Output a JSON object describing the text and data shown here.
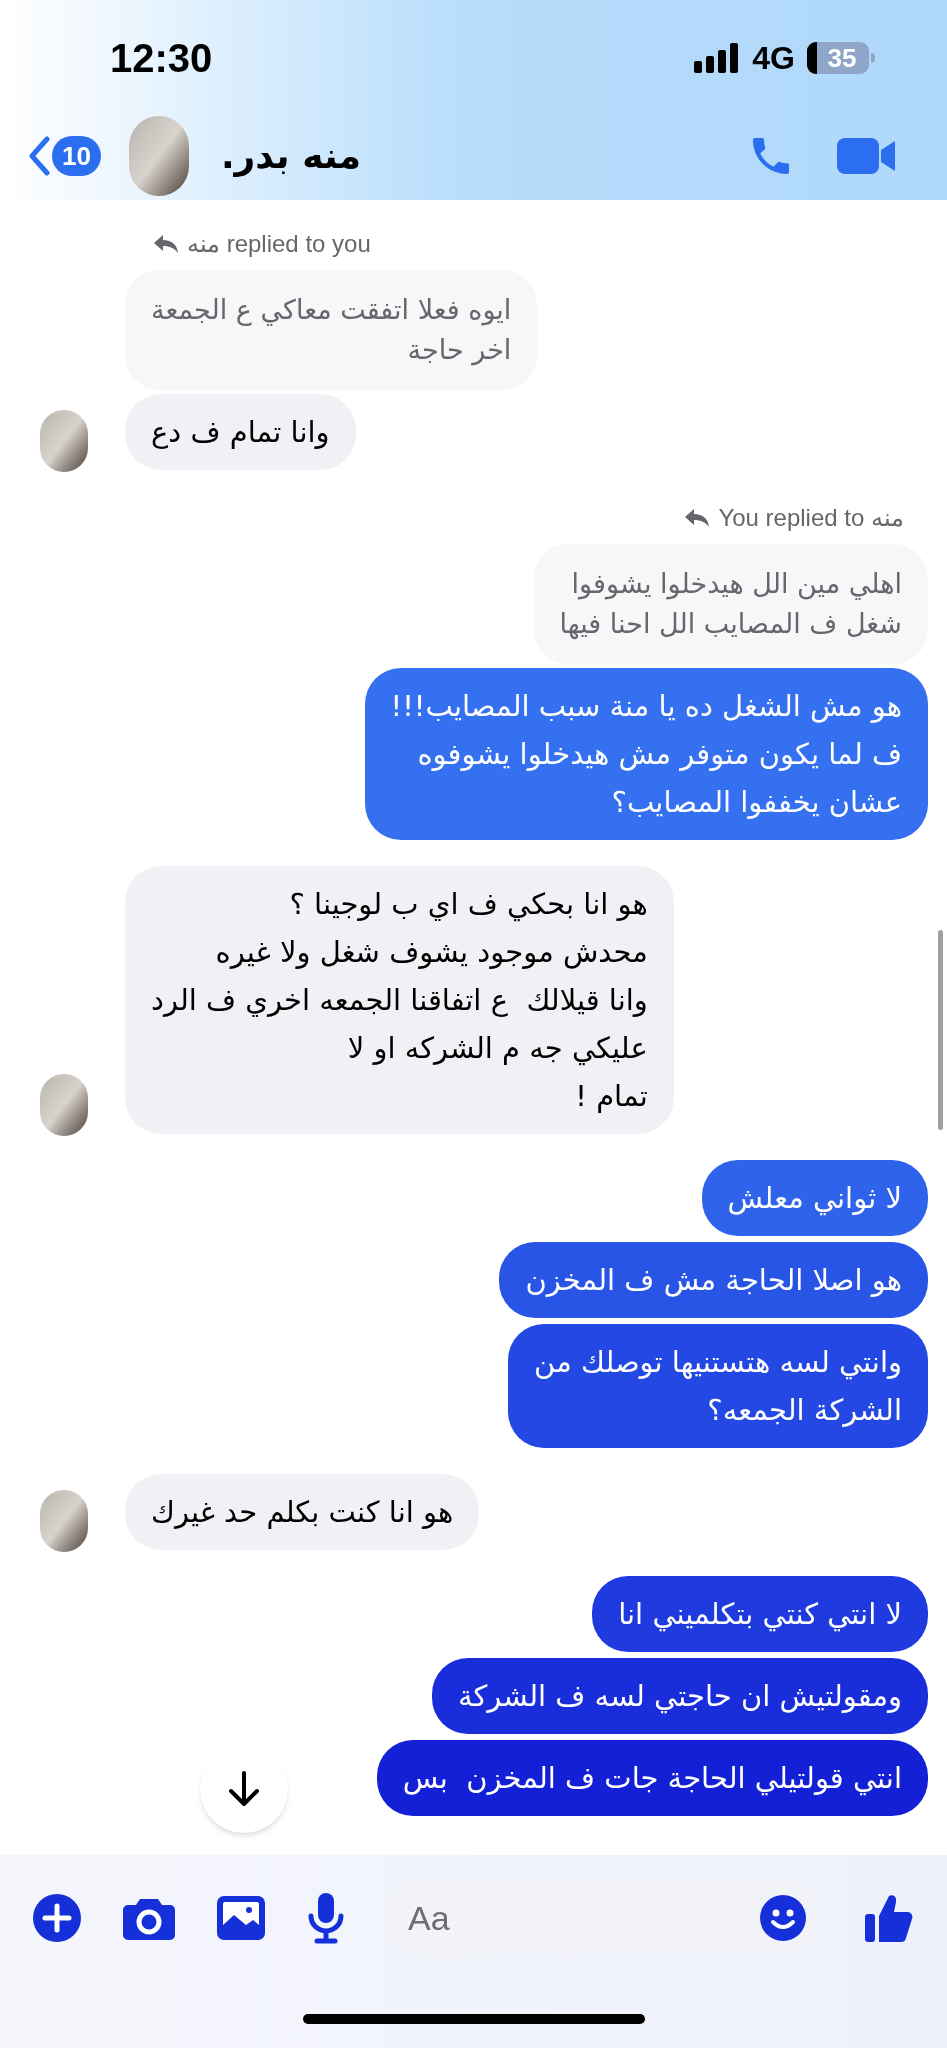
{
  "status_bar": {
    "time": "12:30",
    "network": "4G",
    "battery": "35"
  },
  "header": {
    "back_badge": "10",
    "contact_name": "منه بدر."
  },
  "messages": [
    {
      "kind": "incoming",
      "reply_label": "منه replied to you",
      "quoted": "ايوه فعلا اتفقت معاكي ع الجمعة\nاخر حاجة",
      "text": "وانا تمام ف دع"
    },
    {
      "kind": "outgoing",
      "reply_label": "You replied to منه",
      "quoted": "اهلي مين الل هيدخلوا يشوفوا\nشغل ف المصايب الل احنا فيها",
      "text": "هو مش الشغل ده يا منة سبب المصايب!!!\nف لما يكون متوفر مش هيدخلوا يشوفوه\nعشان يخففوا المصايب؟"
    },
    {
      "kind": "incoming",
      "text": "هو انا بحكي ف اي ب لوجينا ؟\nمحدش موجود يشوف شغل ولا غيره\nوانا قيلالك  ع اتفاقنا الجمعه اخري ف الرد\nعليكي جه م الشركه او لا\nتمام !"
    },
    {
      "kind": "outgoing",
      "text": "لا ثواني معلش"
    },
    {
      "kind": "outgoing",
      "text": "هو اصلا الحاجة مش ف المخزن"
    },
    {
      "kind": "outgoing",
      "text": "وانتي لسه هتستنيها توصلك من\nالشركة الجمعه؟"
    },
    {
      "kind": "incoming",
      "text": "هو انا كنت بكلم حد غيرك"
    },
    {
      "kind": "outgoing",
      "text": "لا انتي كنتي بتكلميني انا"
    },
    {
      "kind": "outgoing",
      "text": "ومقولتيش ان حاجتي لسه ف الشركة"
    },
    {
      "kind": "outgoing",
      "text": "انتي قولتيلي الحاجة جات ف المخزن  بس"
    }
  ],
  "composer": {
    "placeholder": "Aa"
  }
}
